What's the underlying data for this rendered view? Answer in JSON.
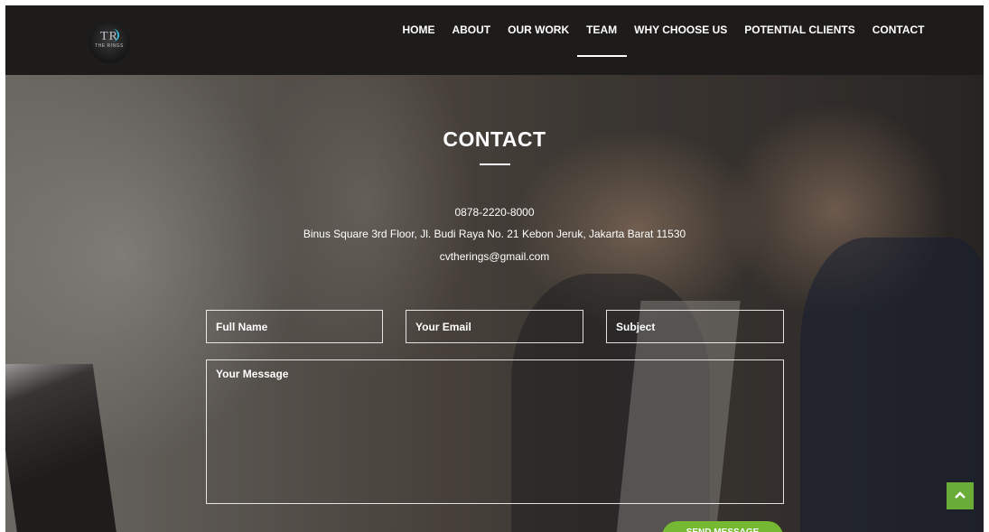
{
  "brand": {
    "logo_mark": "TR",
    "logo_sub": "THE RINGS"
  },
  "nav": {
    "items": [
      {
        "label": "HOME"
      },
      {
        "label": "ABOUT"
      },
      {
        "label": "OUR WORK"
      },
      {
        "label": "TEAM",
        "active": true
      },
      {
        "label": "WHY CHOOSE US"
      },
      {
        "label": "POTENTIAL CLIENTS"
      },
      {
        "label": "CONTACT"
      }
    ]
  },
  "contact": {
    "title": "CONTACT",
    "phone": "0878-2220-8000",
    "address": "Binus Square 3rd Floor, Jl. Budi Raya No. 21 Kebon Jeruk, Jakarta Barat 11530",
    "email": "cvtherings@gmail.com"
  },
  "form": {
    "name_placeholder": "Full Name",
    "email_placeholder": "Your Email",
    "subject_placeholder": "Subject",
    "message_placeholder": "Your Message",
    "send_label": "SEND MESSAGE"
  },
  "icons": {
    "back_to_top": "chevron-up-icon"
  },
  "colors": {
    "navbar": "#1e1c1b",
    "accent_green": "#75b933",
    "text": "#ffffff"
  }
}
